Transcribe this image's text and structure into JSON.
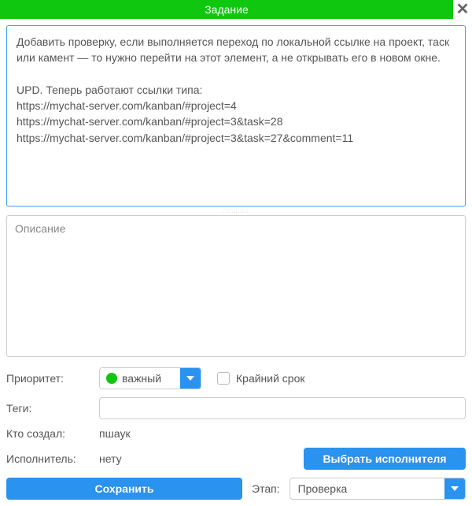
{
  "header": {
    "title": "Задание"
  },
  "task": {
    "title": "Добавить проверку, если выполняется переход по локальной ссылке на проект, таск или камент — то нужно перейти на этот элемент, а не открывать его в новом окне.\n\nUPD. Теперь работают ссылки типа:\nhttps://mychat-server.com/kanban/#project=4\nhttps://mychat-server.com/kanban/#project=3&task=28\nhttps://mychat-server.com/kanban/#project=3&task=27&comment=11",
    "description_placeholder": "Описание",
    "description": ""
  },
  "labels": {
    "priority": "Приоритет:",
    "tags": "Теги:",
    "creator": "Кто создал:",
    "assignee": "Исполнитель:",
    "deadline": "Крайний срок",
    "stage": "Этап:"
  },
  "values": {
    "priority": "важный",
    "priority_color": "#0ec70e",
    "tags": "",
    "creator": "пшаук",
    "assignee": "нету",
    "stage": "Проверка"
  },
  "buttons": {
    "assign": "Выбрать исполнителя",
    "save": "Сохранить"
  }
}
